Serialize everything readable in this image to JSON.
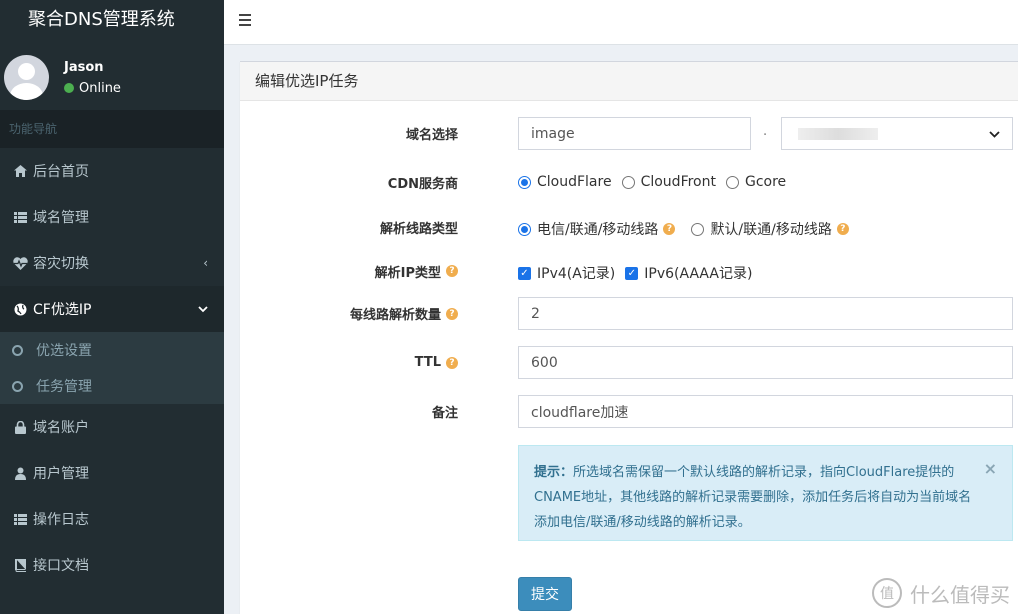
{
  "app": {
    "title": "聚合DNS管理系统"
  },
  "user": {
    "name": "Jason",
    "status": "Online"
  },
  "sidebar": {
    "header": "功能导航",
    "items": [
      {
        "label": "后台首页",
        "icon": "home-icon"
      },
      {
        "label": "域名管理",
        "icon": "list-icon"
      },
      {
        "label": "容灾切换",
        "icon": "heartbeat-icon"
      },
      {
        "label": "CF优选IP",
        "icon": "globe-icon"
      },
      {
        "label": "域名账户",
        "icon": "lock-icon"
      },
      {
        "label": "用户管理",
        "icon": "user-icon"
      },
      {
        "label": "操作日志",
        "icon": "list-icon"
      },
      {
        "label": "接口文档",
        "icon": "book-icon"
      }
    ],
    "submenu": [
      {
        "label": "优选设置"
      },
      {
        "label": "任务管理"
      }
    ]
  },
  "box": {
    "title": "编辑优选IP任务"
  },
  "form": {
    "domain": {
      "label": "域名选择",
      "subdomain_value": "image",
      "separator": "."
    },
    "cdn": {
      "label": "CDN服务商",
      "options": [
        "CloudFlare",
        "CloudFront",
        "Gcore"
      ],
      "selected": "CloudFlare"
    },
    "line_type": {
      "label": "解析线路类型",
      "options": [
        "电信/联通/移动线路",
        "默认/联通/移动线路"
      ],
      "selected": "电信/联通/移动线路"
    },
    "ip_type": {
      "label": "解析IP类型",
      "options": [
        "IPv4(A记录)",
        "IPv6(AAAA记录)"
      ]
    },
    "count": {
      "label": "每线路解析数量",
      "value": "2"
    },
    "ttl": {
      "label": "TTL",
      "value": "600"
    },
    "remark": {
      "label": "备注",
      "value": "cloudflare加速"
    },
    "tip": {
      "title": "提示：",
      "text": "所选域名需保留一个默认线路的解析记录，指向CloudFlare提供的CNAME地址，其他线路的解析记录需要删除，添加任务后将自动为当前域名添加电信/联通/移动线路的解析记录。"
    },
    "submit_label": "提交"
  },
  "watermark": {
    "text": "什么值得买",
    "glyph": "值"
  }
}
